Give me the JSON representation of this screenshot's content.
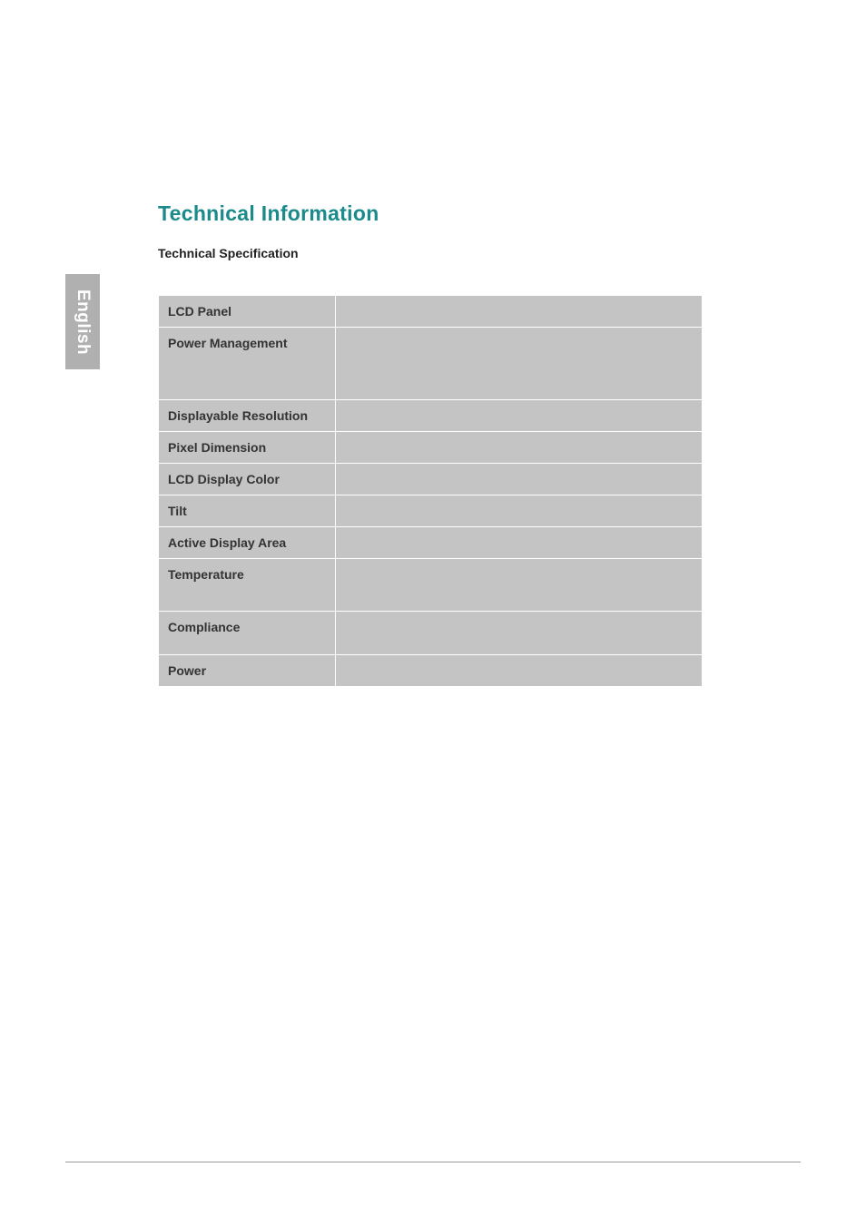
{
  "sideTab": "English",
  "title": "Technical Information",
  "subtitle": "Technical Specification",
  "rows": [
    {
      "label": "LCD Panel",
      "value": ""
    },
    {
      "label": "Power Management",
      "value": ""
    },
    {
      "label": "Displayable Resolution",
      "value": ""
    },
    {
      "label": "Pixel Dimension",
      "value": ""
    },
    {
      "label": "LCD Display Color",
      "value": ""
    },
    {
      "label": "Tilt",
      "value": ""
    },
    {
      "label": "Active Display Area",
      "value": ""
    },
    {
      "label": "Temperature",
      "value": ""
    },
    {
      "label": "Compliance",
      "value": ""
    },
    {
      "label": "Power",
      "value": ""
    }
  ]
}
